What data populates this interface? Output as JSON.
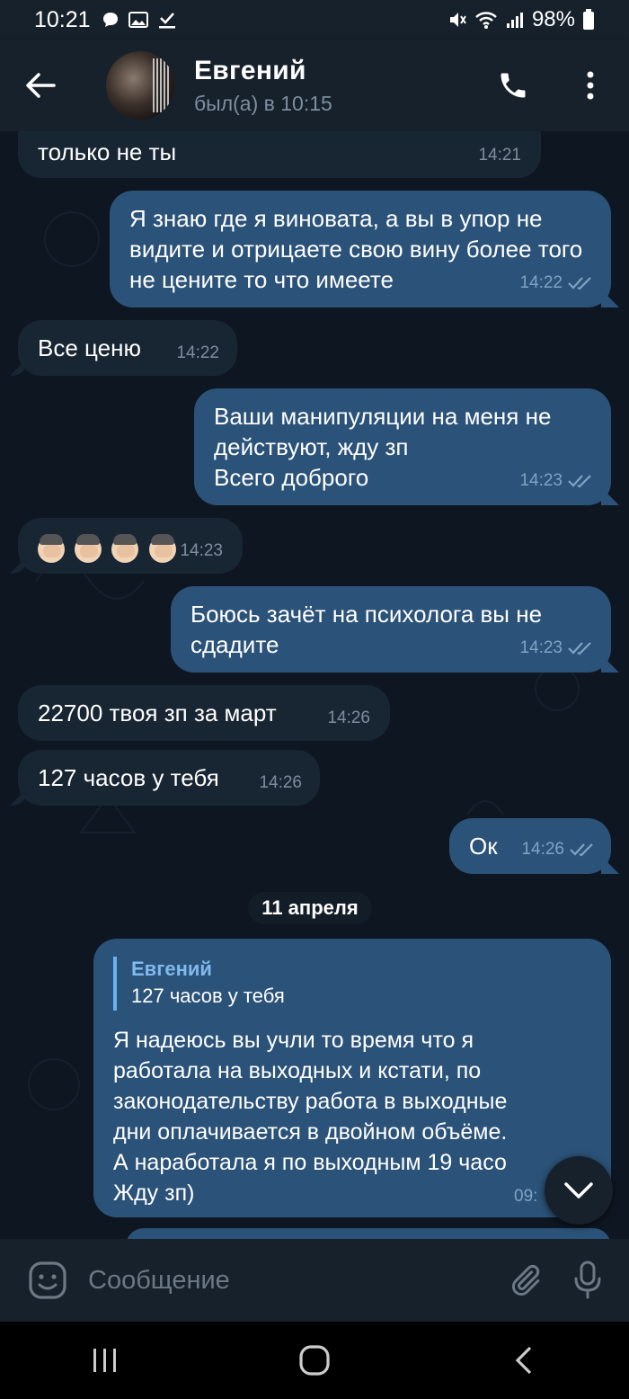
{
  "status_bar": {
    "time": "10:21",
    "battery": "98%"
  },
  "header": {
    "contact_name": "Евгений",
    "last_seen": "был(а) в 10:15"
  },
  "messages": [
    {
      "text": "только не ты",
      "time": "14:21",
      "direction": "in"
    },
    {
      "text": "Я знаю где я виновата, а вы в упор не видите и отрицаете свою вину более того не цените то что имеете",
      "time": "14:22",
      "direction": "out",
      "read": true
    },
    {
      "text": "Все ценю",
      "time": "14:22",
      "direction": "in"
    },
    {
      "text": "Ваши манипуляции на меня не действуют, жду зп\nВсего доброго",
      "time": "14:23",
      "direction": "out",
      "read": true
    },
    {
      "text": "",
      "emoji": "facepalm x4",
      "time": "14:23",
      "direction": "in"
    },
    {
      "text": "Боюсь зачёт на психолога вы не сдадите",
      "time": "14:23",
      "direction": "out",
      "read": true
    },
    {
      "text": "22700 твоя зп за март",
      "time": "14:26",
      "direction": "in"
    },
    {
      "text": "127 часов у тебя",
      "time": "14:26",
      "direction": "in"
    },
    {
      "text": "Ок",
      "time": "14:26",
      "direction": "out",
      "read": true
    }
  ],
  "date_separator": "11 апреля",
  "reply_message": {
    "reply_to_name": "Евгений",
    "reply_to_text": "127 часов у тебя",
    "text_lines": [
      "Я надеюсь вы учли то время что я",
      "работала на выходных и кстати, по",
      "законодательству работа в выходные",
      "дни оплачивается в двойном объёме.",
      "А наработала я по выходным 19 часо",
      "Жду зп)"
    ],
    "time": "09:",
    "direction": "out"
  },
  "input": {
    "placeholder": "Сообщение"
  },
  "colors": {
    "background": "#0e1621",
    "bubble_in": "#182533",
    "bubble_out": "#2b5278",
    "header": "#17212b",
    "accent": "#6ab3f3"
  }
}
